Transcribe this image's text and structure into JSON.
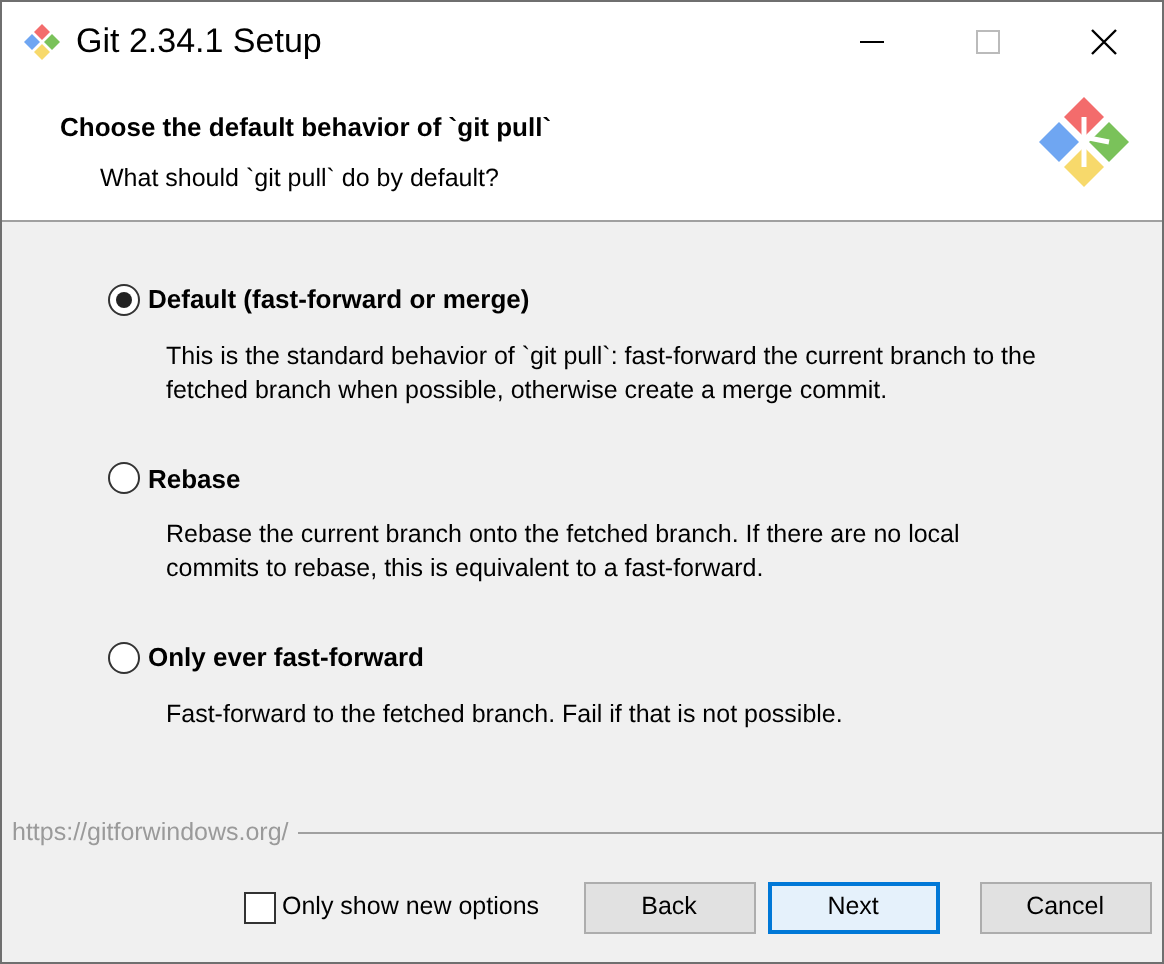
{
  "window": {
    "title": "Git 2.34.1 Setup"
  },
  "header": {
    "title": "Choose the default behavior of `git pull`",
    "subtitle": "What should `git pull` do by default?"
  },
  "options": [
    {
      "label": "Default (fast-forward or merge)",
      "selected": true,
      "description": "This is the standard behavior of `git pull`: fast-forward the current branch to the fetched branch when possible, otherwise create a merge commit."
    },
    {
      "label": "Rebase",
      "selected": false,
      "description": "Rebase the current branch onto the fetched branch. If there are no local commits to rebase, this is equivalent to a fast-forward."
    },
    {
      "label": "Only ever fast-forward",
      "selected": false,
      "description": "Fast-forward to the fetched branch. Fail if that is not possible."
    }
  ],
  "footer": {
    "url": "https://gitforwindows.org/",
    "checkbox": {
      "label": "Only show new options",
      "checked": false
    },
    "buttons": [
      {
        "label": "Back",
        "default": false
      },
      {
        "label": "Next",
        "default": true
      },
      {
        "label": "Cancel",
        "default": false
      }
    ]
  }
}
